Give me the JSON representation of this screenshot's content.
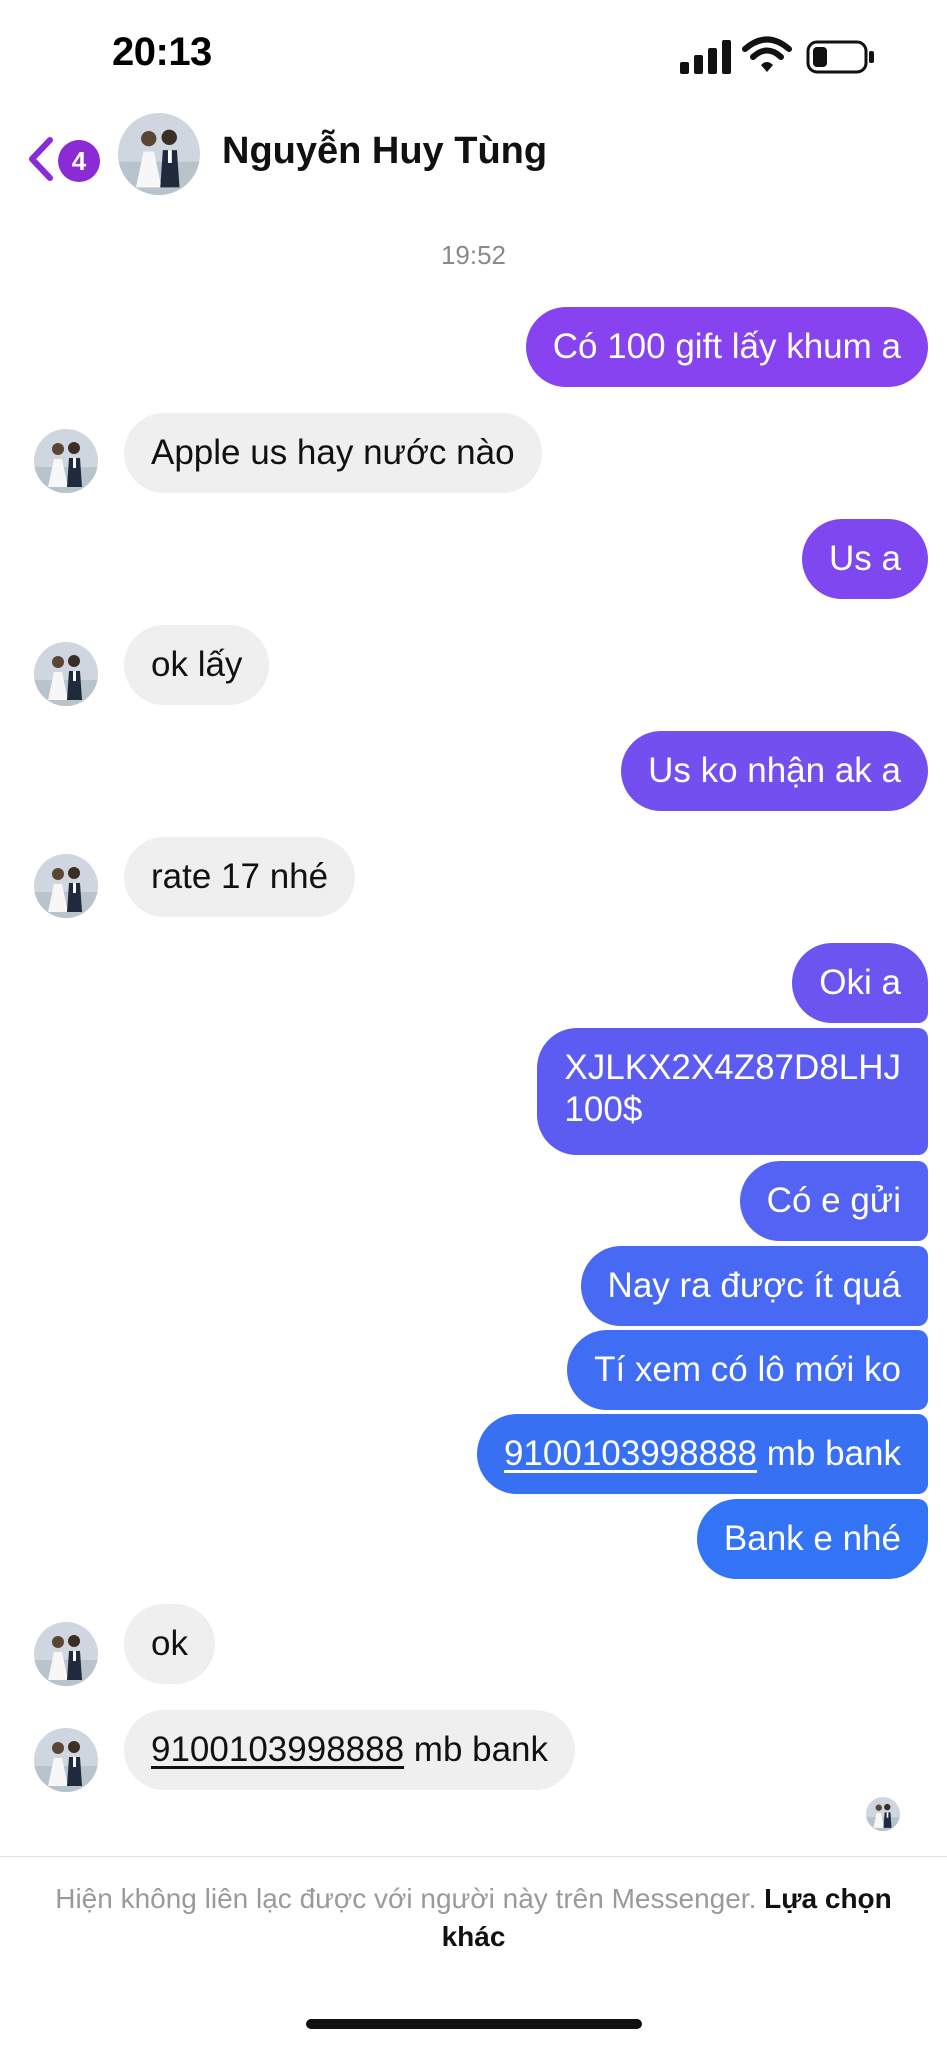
{
  "status_bar": {
    "time": "20:13"
  },
  "header": {
    "back_badge_count": "4",
    "contact_name": "Nguyễn Huy Tùng"
  },
  "conversation": {
    "timestamp": "19:52",
    "messages": [
      {
        "direction": "outgoing",
        "text": "Có 100 gift lấy khum a"
      },
      {
        "direction": "incoming",
        "text": "Apple us hay nước nào"
      },
      {
        "direction": "outgoing",
        "text": "Us a"
      },
      {
        "direction": "incoming",
        "text": "ok lấy"
      },
      {
        "direction": "outgoing",
        "text": "Us ko nhận ak a"
      },
      {
        "direction": "incoming",
        "text": "rate 17 nhé"
      },
      {
        "direction": "outgoing",
        "text": "Oki a"
      },
      {
        "direction": "outgoing",
        "line1": "XJLKX2X4Z87D8LHJ",
        "line2": "100$"
      },
      {
        "direction": "outgoing",
        "text": "Có e gửi"
      },
      {
        "direction": "outgoing",
        "text": "Nay ra được ít quá"
      },
      {
        "direction": "outgoing",
        "text": "Tí xem có lô mới ko"
      },
      {
        "direction": "outgoing",
        "account_number": "9100103998888",
        "suffix": " mb bank"
      },
      {
        "direction": "outgoing",
        "text": "Bank e nhé"
      },
      {
        "direction": "incoming",
        "text": "ok"
      },
      {
        "direction": "incoming",
        "account_number": "9100103998888",
        "suffix": " mb bank"
      }
    ]
  },
  "footer": {
    "notice": "Hiện không liên lạc được với người này trên Messenger.",
    "link": "Lựa chọn khác"
  },
  "colors": {
    "outgoing_gradient_top": "#8a3ef0",
    "outgoing_gradient_bottom": "#2f6ff4",
    "incoming_bubble": "#efefef",
    "accent_purple": "#8a2bd6"
  }
}
